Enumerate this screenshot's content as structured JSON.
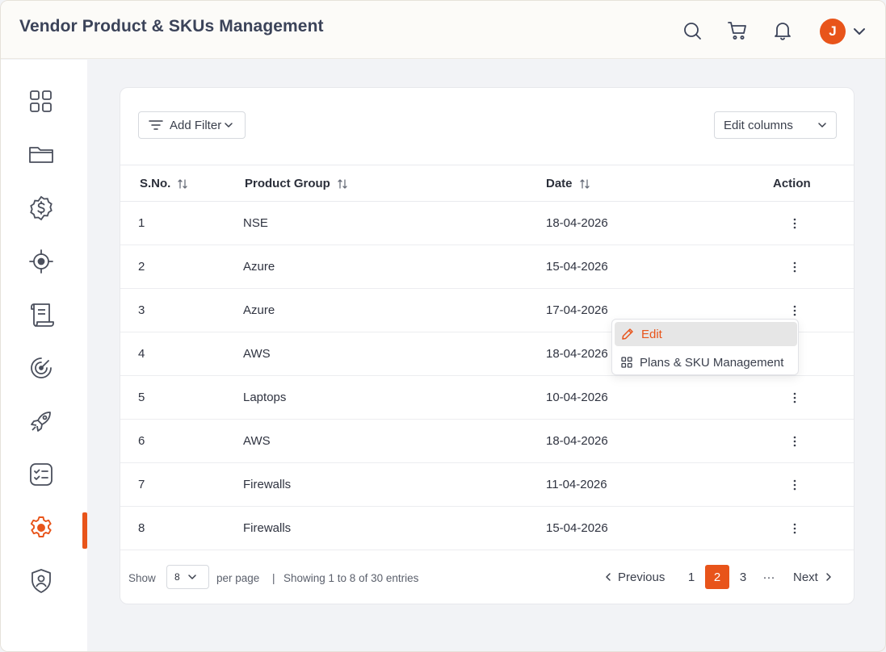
{
  "header": {
    "title": "Vendor Product & SKUs Management",
    "avatar_initial": "J",
    "icons": [
      "search-icon",
      "cart-icon",
      "bell-icon",
      "chevron-down-icon"
    ]
  },
  "sidebar": {
    "items": [
      {
        "icon": "grid-icon"
      },
      {
        "icon": "folder-icon"
      },
      {
        "icon": "dollar-badge-icon"
      },
      {
        "icon": "target-icon"
      },
      {
        "icon": "scroll-icon"
      },
      {
        "icon": "radar-icon"
      },
      {
        "icon": "rocket-icon"
      },
      {
        "icon": "checklist-icon"
      },
      {
        "icon": "gear-icon",
        "active": true
      },
      {
        "icon": "shield-user-icon"
      }
    ]
  },
  "toolbar": {
    "add_filter_label": "Add Filter",
    "edit_columns_label": "Edit columns"
  },
  "table": {
    "columns": [
      "S.No.",
      "Product Group",
      "Date",
      "Action"
    ],
    "rows": [
      {
        "sno": "1",
        "group": "NSE",
        "date": "18-04-2026"
      },
      {
        "sno": "2",
        "group": "Azure",
        "date": "15-04-2026"
      },
      {
        "sno": "3",
        "group": "Azure",
        "date": "17-04-2026"
      },
      {
        "sno": "4",
        "group": "AWS",
        "date": "18-04-2026"
      },
      {
        "sno": "5",
        "group": "Laptops",
        "date": "10-04-2026"
      },
      {
        "sno": "6",
        "group": "AWS",
        "date": "18-04-2026"
      },
      {
        "sno": "7",
        "group": "Firewalls",
        "date": "11-04-2026"
      },
      {
        "sno": "8",
        "group": "Firewalls",
        "date": "15-04-2026"
      }
    ]
  },
  "action_menu": {
    "edit_label": "Edit",
    "plans_label": "Plans & SKU Management"
  },
  "footer": {
    "show_label": "Show",
    "per_page_value": "8",
    "per_page_label": "per page",
    "separator": "|",
    "showing_text": "Showing 1 to 8 of 30 entries",
    "previous_label": "Previous",
    "next_label": "Next",
    "pages": [
      "1",
      "2",
      "3"
    ],
    "current_page": "2",
    "ellipsis": "···"
  },
  "colors": {
    "accent": "#e8541a",
    "text_dark": "#2b2f3a",
    "background": "#f2f3f6"
  }
}
